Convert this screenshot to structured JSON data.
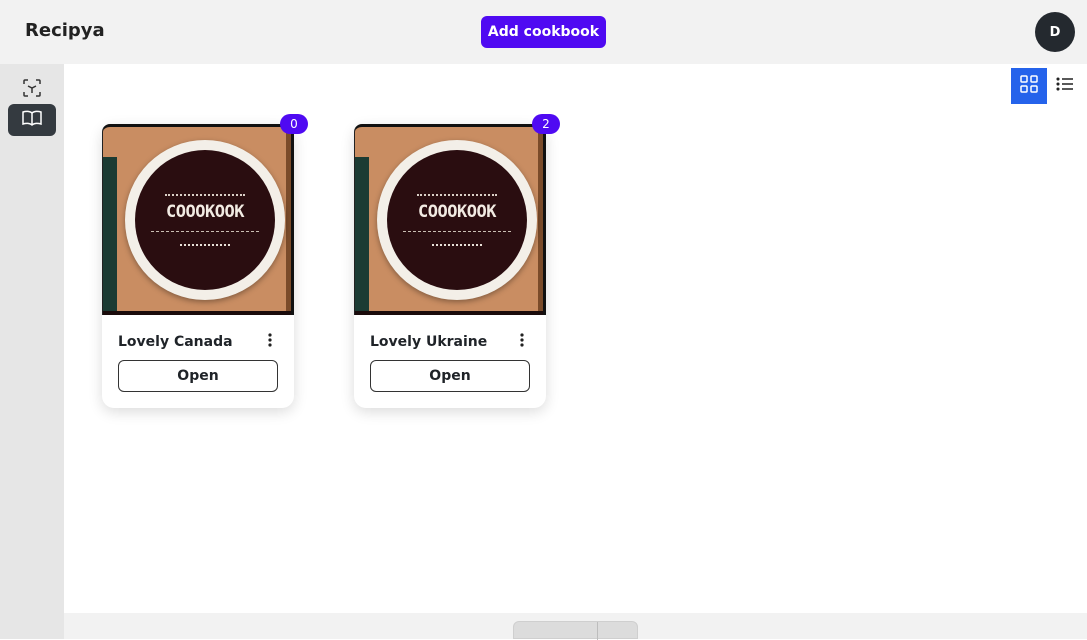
{
  "app": {
    "title": "Recipya"
  },
  "header": {
    "add_cookbook_label": "Add cookbook",
    "avatar_initial": "D"
  },
  "sidebar": {
    "items": [
      {
        "name": "recipes",
        "icon": "cube-scan-icon"
      },
      {
        "name": "cookbooks",
        "icon": "open-book-icon",
        "active": true
      }
    ]
  },
  "view_toggle": {
    "grid_icon": "grid-icon",
    "list_icon": "list-icon",
    "active": "grid"
  },
  "cookbooks": [
    {
      "title": "Lovely Canada",
      "count": "0",
      "open_label": "Open",
      "cover_text": "COOOKOOK"
    },
    {
      "title": "Lovely Ukraine",
      "count": "2",
      "open_label": "Open",
      "cover_text": "COOOKOOK"
    }
  ],
  "colors": {
    "accent": "#4f0af2",
    "grid_active": "#2563eb",
    "sidebar_active": "#343a40"
  }
}
